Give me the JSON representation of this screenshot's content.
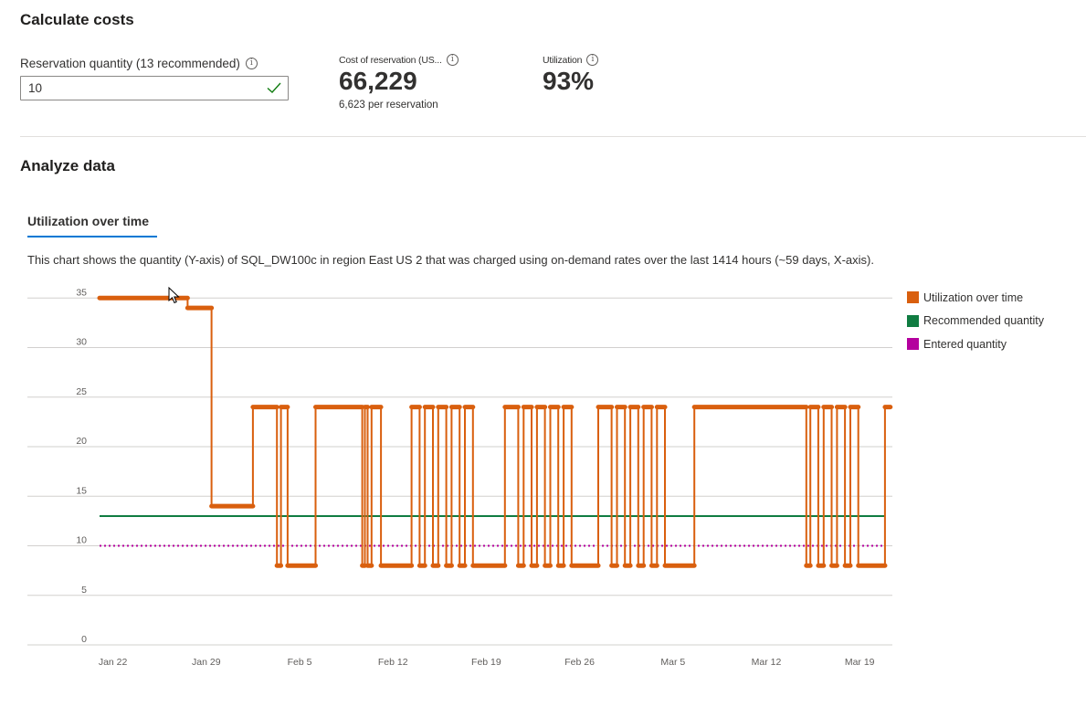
{
  "calculate": {
    "title": "Calculate costs",
    "quantity_label": "Reservation quantity (13 recommended)",
    "quantity_value": "10"
  },
  "metrics": {
    "cost_label": "Cost of reservation (US...",
    "cost_value": "66,229",
    "cost_sub": "6,623 per reservation",
    "utilization_label": "Utilization",
    "utilization_value": "93%"
  },
  "analyze": {
    "title": "Analyze data",
    "tab_label": "Utilization over time",
    "description": "This chart shows the quantity (Y-axis) of SQL_DW100c in region East US 2 that was charged using on-demand rates over the last 1414 hours (~59 days, X-axis)."
  },
  "icons": {
    "info": "info-icon",
    "check": "check-icon"
  },
  "colors": {
    "utilization": "#d95f0e",
    "recommended": "#107c41",
    "entered": "#b4009e",
    "accent": "#0078d4"
  },
  "chart_data": {
    "type": "line",
    "x_tick_labels": [
      "Jan 22",
      "Jan 29",
      "Feb 5",
      "Feb 12",
      "Feb 19",
      "Feb 26",
      "Mar 5",
      "Mar 12",
      "Mar 19"
    ],
    "y_ticks": [
      0,
      5,
      10,
      15,
      20,
      25,
      30,
      35
    ],
    "ylim": [
      0,
      35
    ],
    "x_unit": "days since Jan 21",
    "grid": true,
    "legend_position": "right",
    "series": [
      {
        "name": "Utilization over time",
        "color": "#d95f0e",
        "style": "step",
        "points": [
          [
            0.0,
            35
          ],
          [
            6.6,
            35
          ],
          [
            6.6,
            34
          ],
          [
            8.4,
            34
          ],
          [
            8.4,
            14
          ],
          [
            11.5,
            14
          ],
          [
            11.5,
            24
          ],
          [
            13.3,
            24
          ],
          [
            13.3,
            8
          ],
          [
            13.6,
            8
          ],
          [
            13.6,
            24
          ],
          [
            14.1,
            24
          ],
          [
            14.1,
            8
          ],
          [
            16.2,
            8
          ],
          [
            16.2,
            24
          ],
          [
            19.7,
            24
          ],
          [
            19.7,
            8
          ],
          [
            19.9,
            8
          ],
          [
            19.9,
            24
          ],
          [
            20.1,
            24
          ],
          [
            20.1,
            8
          ],
          [
            20.4,
            8
          ],
          [
            20.4,
            24
          ],
          [
            21.1,
            24
          ],
          [
            21.1,
            8
          ],
          [
            23.4,
            8
          ],
          [
            23.4,
            24
          ],
          [
            24.0,
            24
          ],
          [
            24.0,
            8
          ],
          [
            24.4,
            8
          ],
          [
            24.4,
            24
          ],
          [
            25.0,
            24
          ],
          [
            25.0,
            8
          ],
          [
            25.4,
            8
          ],
          [
            25.4,
            24
          ],
          [
            26.0,
            24
          ],
          [
            26.0,
            8
          ],
          [
            26.4,
            8
          ],
          [
            26.4,
            24
          ],
          [
            27.0,
            24
          ],
          [
            27.0,
            8
          ],
          [
            27.4,
            8
          ],
          [
            27.4,
            24
          ],
          [
            28.0,
            24
          ],
          [
            28.0,
            8
          ],
          [
            30.4,
            8
          ],
          [
            30.4,
            24
          ],
          [
            31.4,
            24
          ],
          [
            31.4,
            8
          ],
          [
            31.8,
            8
          ],
          [
            31.8,
            24
          ],
          [
            32.4,
            24
          ],
          [
            32.4,
            8
          ],
          [
            32.8,
            8
          ],
          [
            32.8,
            24
          ],
          [
            33.4,
            24
          ],
          [
            33.4,
            8
          ],
          [
            33.8,
            8
          ],
          [
            33.8,
            24
          ],
          [
            34.4,
            24
          ],
          [
            34.4,
            8
          ],
          [
            34.8,
            8
          ],
          [
            34.8,
            24
          ],
          [
            35.4,
            24
          ],
          [
            35.4,
            8
          ],
          [
            37.4,
            8
          ],
          [
            37.4,
            24
          ],
          [
            38.4,
            24
          ],
          [
            38.4,
            8
          ],
          [
            38.8,
            8
          ],
          [
            38.8,
            24
          ],
          [
            39.4,
            24
          ],
          [
            39.4,
            8
          ],
          [
            39.8,
            8
          ],
          [
            39.8,
            24
          ],
          [
            40.4,
            24
          ],
          [
            40.4,
            8
          ],
          [
            40.8,
            8
          ],
          [
            40.8,
            24
          ],
          [
            41.4,
            24
          ],
          [
            41.4,
            8
          ],
          [
            41.8,
            8
          ],
          [
            41.8,
            24
          ],
          [
            42.4,
            24
          ],
          [
            42.4,
            8
          ],
          [
            44.6,
            8
          ],
          [
            44.6,
            24
          ],
          [
            53.0,
            24
          ],
          [
            53.0,
            8
          ],
          [
            53.3,
            8
          ],
          [
            53.3,
            24
          ],
          [
            53.9,
            24
          ],
          [
            53.9,
            8
          ],
          [
            54.3,
            8
          ],
          [
            54.3,
            24
          ],
          [
            54.9,
            24
          ],
          [
            54.9,
            8
          ],
          [
            55.3,
            8
          ],
          [
            55.3,
            24
          ],
          [
            55.9,
            24
          ],
          [
            55.9,
            8
          ],
          [
            56.3,
            8
          ],
          [
            56.3,
            24
          ],
          [
            56.9,
            24
          ],
          [
            56.9,
            8
          ],
          [
            58.9,
            8
          ],
          [
            58.9,
            24
          ],
          [
            59.3,
            24
          ]
        ]
      },
      {
        "name": "Recommended quantity",
        "color": "#107c41",
        "style": "solid",
        "x": [
          0,
          58.9
        ],
        "y": [
          13,
          13
        ]
      },
      {
        "name": "Entered quantity",
        "color": "#b4009e",
        "style": "dotted",
        "x": [
          0,
          58.9
        ],
        "y": [
          10,
          10
        ]
      }
    ]
  }
}
